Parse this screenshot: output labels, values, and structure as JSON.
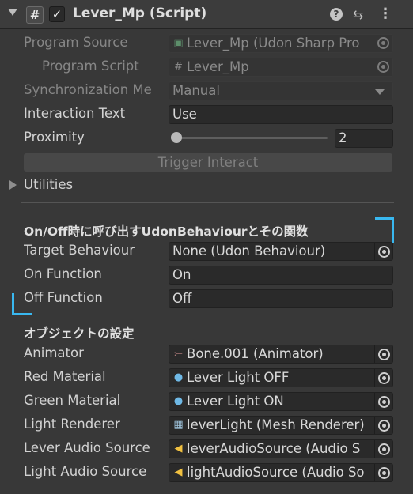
{
  "component": {
    "title": "Lever_Mp (Script)",
    "enabled_check": "✓"
  },
  "header_icons": {
    "help": "help-icon",
    "presets": "presets-icon",
    "menu": "kebab-menu-icon"
  },
  "fields": {
    "program_source": {
      "label": "Program Source",
      "value": "Lever_Mp (Udon Sharp Pro"
    },
    "program_script": {
      "label": "Program Script",
      "value": "Lever_Mp"
    },
    "sync_method": {
      "label": "Synchronization Me",
      "value": "Manual"
    },
    "interaction_text": {
      "label": "Interaction Text",
      "value": "Use"
    },
    "proximity": {
      "label": "Proximity",
      "value": "2",
      "slider_fraction": 0.0
    },
    "trigger_button": "Trigger Interact",
    "utilities": "Utilities"
  },
  "section1": {
    "title": "On/Off時に呼び出すUdonBehaviourとその関数",
    "target_behaviour": {
      "label": "Target Behaviour",
      "value": "None (Udon Behaviour)"
    },
    "on_function": {
      "label": "On Function",
      "value": "On"
    },
    "off_function": {
      "label": "Off Function",
      "value": "Off"
    }
  },
  "section2": {
    "title": "オブジェクトの設定",
    "animator": {
      "label": "Animator",
      "value": "Bone.001 (Animator)"
    },
    "red_material": {
      "label": "Red Material",
      "value": "Lever Light OFF"
    },
    "green_material": {
      "label": "Green Material",
      "value": "Lever Light ON"
    },
    "light_renderer": {
      "label": "Light Renderer",
      "value": "leverLight (Mesh Renderer)"
    },
    "lever_audio": {
      "label": "Lever Audio Source",
      "value": "leverAudioSource (Audio S"
    },
    "light_audio": {
      "label": "Light Audio Source",
      "value": "lightAudioSource (Audio So"
    }
  },
  "colors": {
    "accent_bracket": "#39b8f0",
    "background": "#383838",
    "field_bg": "#2a2a2a"
  }
}
